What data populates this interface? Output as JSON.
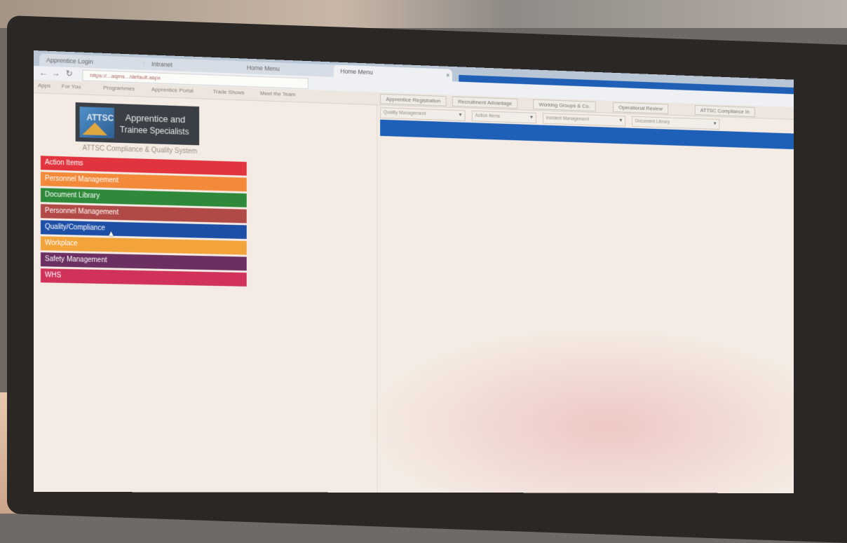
{
  "browser": {
    "tabs": [
      {
        "label": "Apprentice Login",
        "active": false
      },
      {
        "label": "Intranet",
        "active": false
      },
      {
        "label": "Home Menu",
        "active": false
      },
      {
        "label": "Home Menu",
        "active": true
      }
    ],
    "url": "https://...aqms.../default.aspx",
    "bookmarks_label": "Apps"
  },
  "bookmarks_bar": {
    "items": [
      "For You",
      "Programmes",
      "Apprentice Portal",
      "Trade Shows",
      "Meet the Team"
    ],
    "buttons": [
      "Apprentice Registration",
      "Recruitment Advantage",
      "Working Groups & Co.",
      "Operational Review",
      "ATTSC Compliance In"
    ]
  },
  "header": {
    "logo_abbr": "ATTSC",
    "logo_line1": "Apprentice and",
    "logo_line2": "Trainee Specialists",
    "subtitle": "ATTSC Compliance & Quality System"
  },
  "sidebar": {
    "items": [
      {
        "label": "Action Items",
        "color": "#e2343f"
      },
      {
        "label": "Personnel Management",
        "color": "#f28a3a"
      },
      {
        "label": "Document Library",
        "color": "#2e8a3a"
      },
      {
        "label": "Personnel Management",
        "color": "#b14a46"
      },
      {
        "label": "Quality/Compliance",
        "color": "#1e4fa6"
      },
      {
        "label": "Workplace",
        "color": "#f2a33a"
      },
      {
        "label": "Safety Management",
        "color": "#6b2f62"
      },
      {
        "label": "WHS",
        "color": "#d0325a"
      }
    ]
  },
  "top_dropdowns": [
    {
      "label": "Quality Management"
    },
    {
      "label": "Action Items"
    },
    {
      "label": "Incident Management"
    },
    {
      "label": "Document Library"
    }
  ],
  "colors": {
    "accent_blue": "#1e5fb8"
  }
}
